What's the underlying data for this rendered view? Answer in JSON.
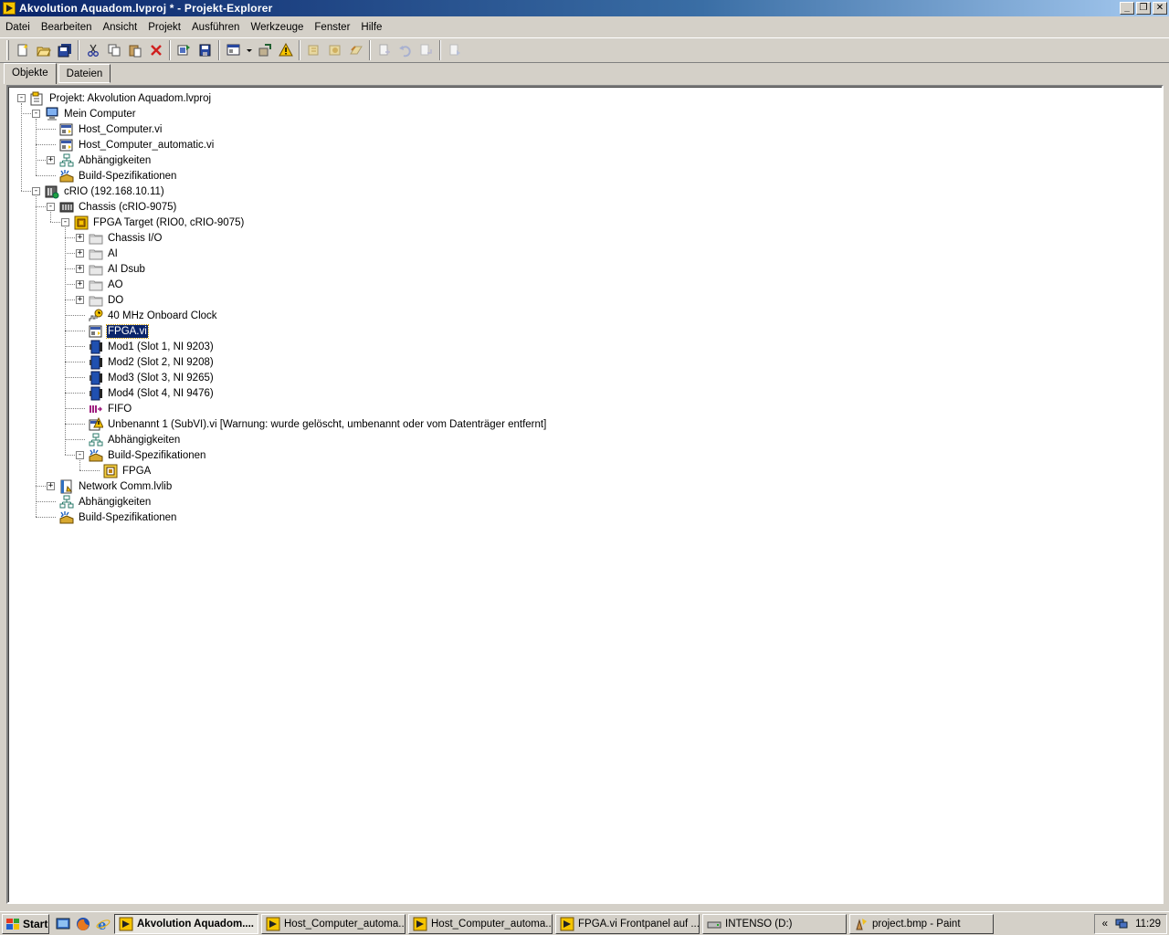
{
  "window": {
    "title": "Akvolution Aquadom.lvproj * - Projekt-Explorer",
    "buttons": [
      "_",
      "❐",
      "✕"
    ]
  },
  "menubar": {
    "items": [
      "Datei",
      "Bearbeiten",
      "Ansicht",
      "Projekt",
      "Ausführen",
      "Werkzeuge",
      "Fenster",
      "Hilfe"
    ]
  },
  "toolbar": {
    "icons": [
      "new-icon",
      "open-icon",
      "save-all-icon",
      "cut-icon",
      "copy-icon",
      "paste-icon",
      "delete-icon",
      "deploy-icon",
      "save-as-icon",
      "view-icon",
      "dropdown-icon",
      "properties-icon",
      "warning-icon",
      "build-icon",
      "build2-icon",
      "build3-icon",
      "add-file-icon",
      "undo-icon",
      "redo-icon",
      "help-icon"
    ]
  },
  "tabs": [
    {
      "label": "Objekte",
      "active": true
    },
    {
      "label": "Dateien",
      "active": false
    }
  ],
  "tree": [
    {
      "label": "Projekt: Akvolution Aquadom.lvproj",
      "level": 0,
      "icon": "project",
      "expander": "-"
    },
    {
      "label": "Mein Computer",
      "level": 1,
      "icon": "computer",
      "expander": "-"
    },
    {
      "label": "Host_Computer.vi",
      "level": 2,
      "icon": "vi",
      "expander": ""
    },
    {
      "label": "Host_Computer_automatic.vi",
      "level": 2,
      "icon": "vi",
      "expander": ""
    },
    {
      "label": "Abhängigkeiten",
      "level": 2,
      "icon": "dependencies",
      "expander": "+"
    },
    {
      "label": "Build-Spezifikationen",
      "level": 2,
      "icon": "build-spec",
      "expander": ""
    },
    {
      "label": "cRIO (192.168.10.11)",
      "level": 1,
      "icon": "crio",
      "expander": "-"
    },
    {
      "label": "Chassis (cRIO-9075)",
      "level": 2,
      "icon": "chassis",
      "expander": "-"
    },
    {
      "label": "FPGA Target (RIO0, cRIO-9075)",
      "level": 3,
      "icon": "fpga",
      "expander": "-"
    },
    {
      "label": "Chassis I/O",
      "level": 4,
      "icon": "folder",
      "expander": "+"
    },
    {
      "label": "AI",
      "level": 4,
      "icon": "folder",
      "expander": "+"
    },
    {
      "label": "AI Dsub",
      "level": 4,
      "icon": "folder",
      "expander": "+"
    },
    {
      "label": "AO",
      "level": 4,
      "icon": "folder",
      "expander": "+"
    },
    {
      "label": "DO",
      "level": 4,
      "icon": "folder",
      "expander": "+"
    },
    {
      "label": "40 MHz Onboard Clock",
      "level": 4,
      "icon": "clock",
      "expander": ""
    },
    {
      "label": "FPGA.vi",
      "level": 4,
      "icon": "vi",
      "expander": "",
      "selected": true
    },
    {
      "label": "Mod1 (Slot 1, NI 9203)",
      "level": 4,
      "icon": "module",
      "expander": ""
    },
    {
      "label": "Mod2 (Slot 2, NI 9208)",
      "level": 4,
      "icon": "module",
      "expander": ""
    },
    {
      "label": "Mod3 (Slot 3, NI 9265)",
      "level": 4,
      "icon": "module",
      "expander": ""
    },
    {
      "label": "Mod4 (Slot 4, NI 9476)",
      "level": 4,
      "icon": "module",
      "expander": ""
    },
    {
      "label": "FIFO",
      "level": 4,
      "icon": "fifo",
      "expander": ""
    },
    {
      "label": "Unbenannt 1 (SubVI).vi  [Warnung:  wurde gelöscht, umbenannt oder vom Datenträger entfernt]",
      "level": 4,
      "icon": "vi-warning",
      "expander": ""
    },
    {
      "label": "Abhängigkeiten",
      "level": 4,
      "icon": "dependencies",
      "expander": ""
    },
    {
      "label": "Build-Spezifikationen",
      "level": 4,
      "icon": "build-spec",
      "expander": "-"
    },
    {
      "label": "FPGA",
      "level": 5,
      "icon": "fpga-build",
      "expander": ""
    },
    {
      "label": "Network Comm.lvlib",
      "level": 2,
      "icon": "library",
      "expander": "+"
    },
    {
      "label": "Abhängigkeiten",
      "level": 2,
      "icon": "dependencies",
      "expander": ""
    },
    {
      "label": "Build-Spezifikationen",
      "level": 2,
      "icon": "build-spec",
      "expander": ""
    }
  ],
  "taskbar": {
    "start_label": "Start",
    "tasks": [
      {
        "label": "Akvolution Aquadom....",
        "active": true
      },
      {
        "label": "Host_Computer_automa...",
        "active": false
      },
      {
        "label": "Host_Computer_automa...",
        "active": false
      },
      {
        "label": "FPGA.vi Frontpanel auf ...",
        "active": false
      },
      {
        "label": "INTENSO (D:)",
        "active": false
      },
      {
        "label": "project.bmp - Paint",
        "active": false
      }
    ],
    "tray_expand": "«",
    "clock": "11:29"
  },
  "colors": {
    "titlebar": "#0a246a",
    "selection": "#0a246a",
    "face": "#d4d0c8"
  }
}
